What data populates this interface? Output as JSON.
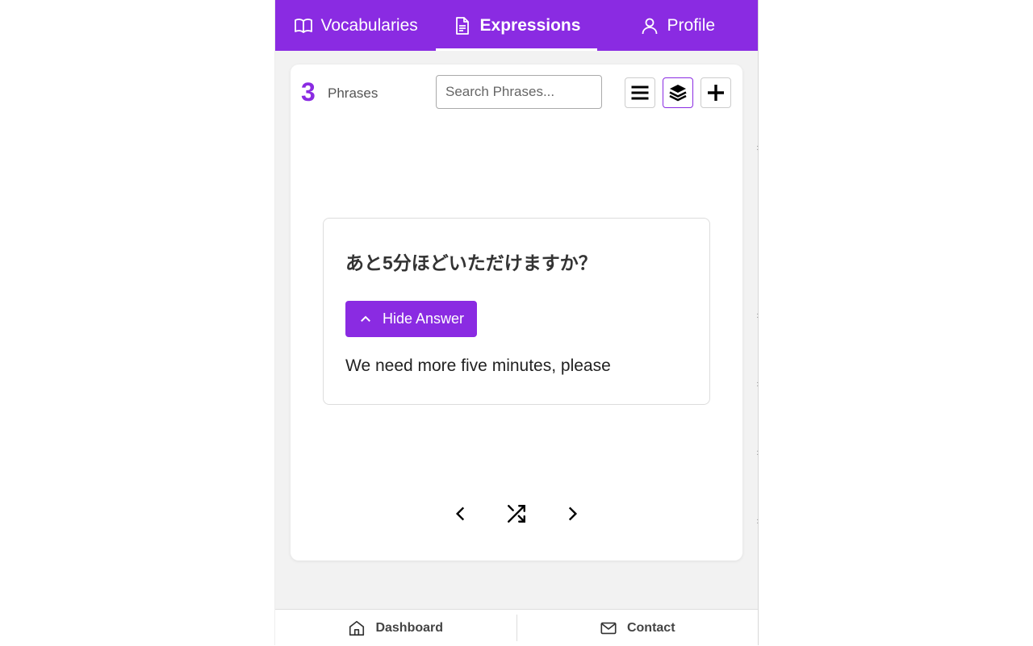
{
  "nav": {
    "tabs": [
      {
        "label": "Vocabularies",
        "icon": "book-icon"
      },
      {
        "label": "Expressions",
        "icon": "document-icon"
      },
      {
        "label": "Profile",
        "icon": "user-icon"
      }
    ],
    "active_tab": "Expressions"
  },
  "toolbar": {
    "count": "3",
    "count_label": "Phrases",
    "search_placeholder": "Search Phrases...",
    "buttons": [
      {
        "icon": "list-icon",
        "selected": false
      },
      {
        "icon": "layers-icon",
        "selected": true
      },
      {
        "icon": "plus-icon",
        "selected": false
      }
    ]
  },
  "flashcard": {
    "question": "あと5分ほどいただけますか？",
    "hide_answer_label": "Hide Answer",
    "answer": "We need more five minutes, please"
  },
  "controls": [
    {
      "icon": "chevron-left-icon"
    },
    {
      "icon": "shuffle-icon"
    },
    {
      "icon": "chevron-right-icon"
    }
  ],
  "bottom_nav": {
    "items": [
      {
        "label": "Dashboard",
        "icon": "home-icon"
      },
      {
        "label": "Contact",
        "icon": "mail-icon"
      }
    ]
  },
  "colors": {
    "accent": "#8a2be2",
    "background": "#f2f2f2"
  }
}
